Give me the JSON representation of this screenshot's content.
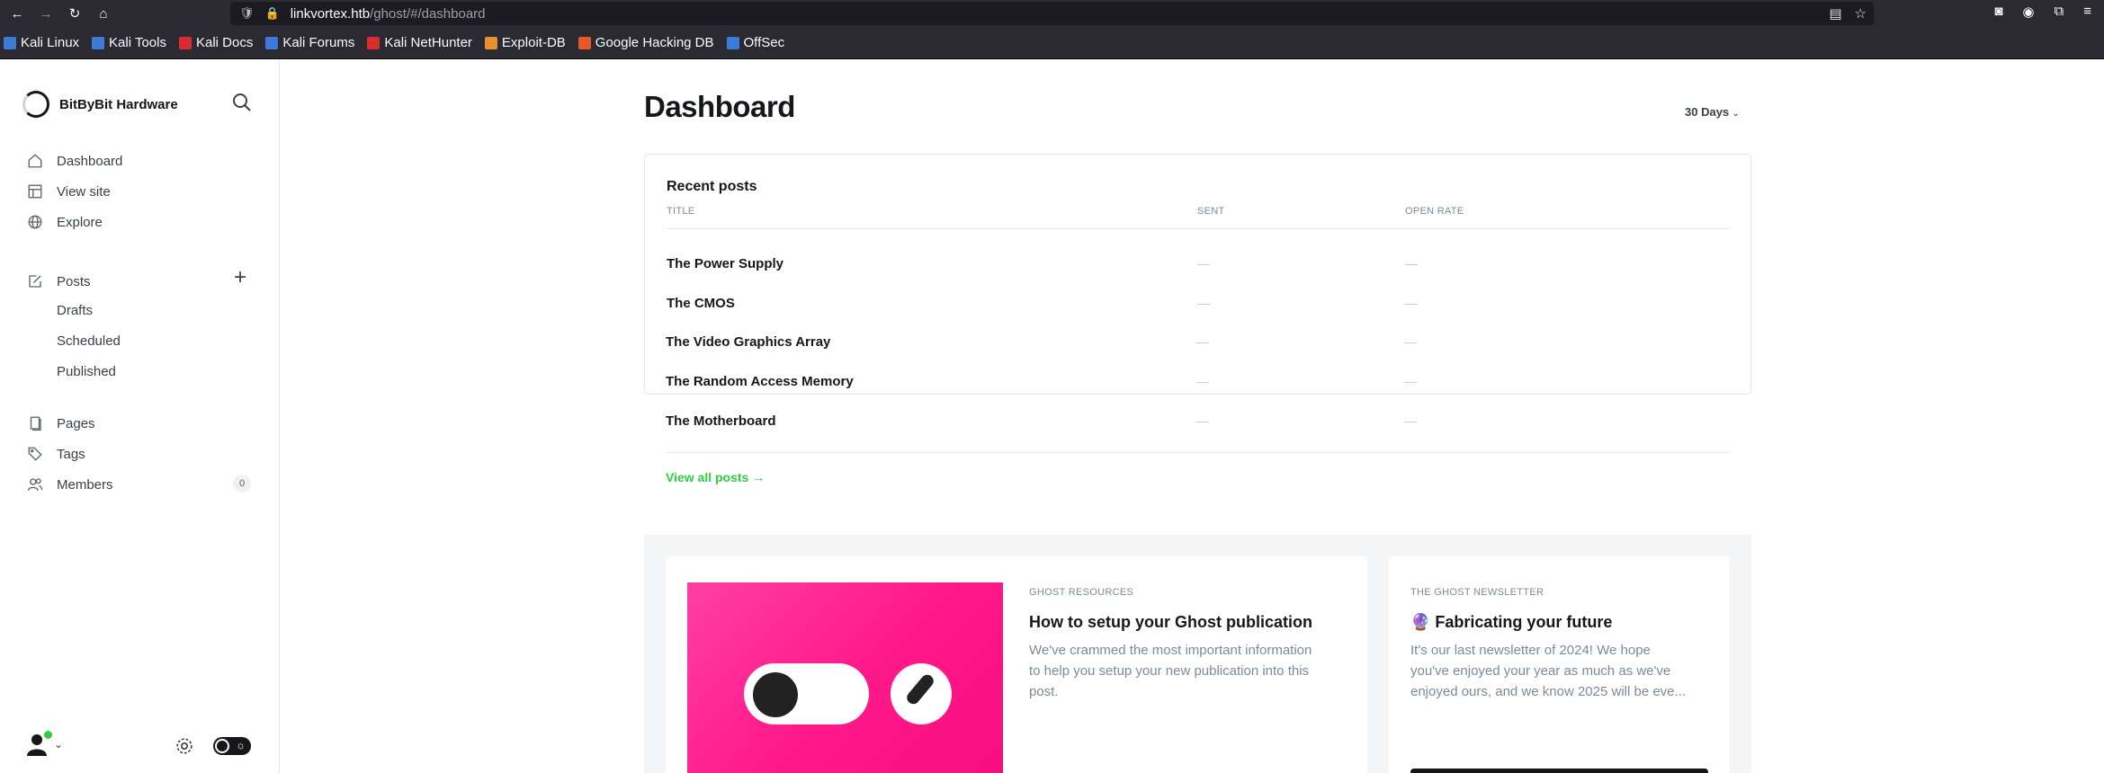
{
  "browser": {
    "url_host": "linkvortex.htb",
    "url_path": "/ghost/#/dashboard",
    "bookmarks": [
      "Kali Linux",
      "Kali Tools",
      "Kali Docs",
      "Kali Forums",
      "Kali NetHunter",
      "Exploit-DB",
      "Google Hacking DB",
      "OffSec"
    ],
    "bookmark_colors": [
      "#3d7bd9",
      "#3d7bd9",
      "#d92c2c",
      "#3d7bd9",
      "#d92c2c",
      "#e8902c",
      "#e8562c",
      "#3d7bd9"
    ]
  },
  "sidebar": {
    "site_title": "BitByBit Hardware",
    "nav": {
      "dashboard": "Dashboard",
      "view_site": "View site",
      "explore": "Explore",
      "posts": "Posts",
      "drafts": "Drafts",
      "scheduled": "Scheduled",
      "published": "Published",
      "pages": "Pages",
      "tags": "Tags",
      "members": "Members",
      "members_count": "0"
    }
  },
  "main": {
    "title": "Dashboard",
    "range": "30 Days",
    "recent_posts": {
      "title": "Recent posts",
      "columns": [
        "TITLE",
        "SENT",
        "OPEN RATE"
      ],
      "rows": [
        {
          "title": "The Power Supply",
          "sent": "—",
          "open_rate": "—"
        },
        {
          "title": "The CMOS",
          "sent": "—",
          "open_rate": "—"
        },
        {
          "title": "The Video Graphics Array",
          "sent": "—",
          "open_rate": "—"
        },
        {
          "title": "The Random Access Memory",
          "sent": "—",
          "open_rate": "—"
        },
        {
          "title": "The Motherboard",
          "sent": "—",
          "open_rate": "—"
        }
      ],
      "view_all": "View all posts →"
    },
    "resources": {
      "eyebrow": "GHOST RESOURCES",
      "title": "How to setup your Ghost publication",
      "desc_lines": [
        "We've crammed the most important information",
        "to help you setup your new publication into this",
        "post."
      ]
    },
    "newsletter": {
      "eyebrow": "THE GHOST NEWSLETTER",
      "title": "🔮 Fabricating your future",
      "desc_lines": [
        "It's our last newsletter of 2024! We hope",
        "you've enjoyed your year as much as we've",
        "enjoyed ours, and we know 2025 will be eve..."
      ]
    }
  },
  "colors": {
    "accent": "#30cf43",
    "brand_pink": "#ff1a8c"
  }
}
